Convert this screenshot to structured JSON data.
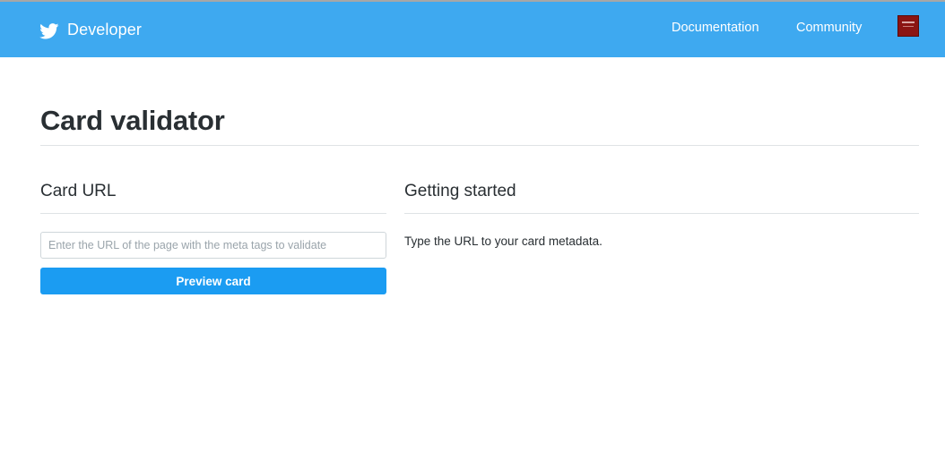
{
  "navbar": {
    "brand_icon": "twitter-bird-icon",
    "brand_label": "Developer",
    "links": [
      {
        "label": "Documentation"
      },
      {
        "label": "Community"
      }
    ],
    "avatar_icon": "user-avatar",
    "background_color": "#3ea9f0"
  },
  "page": {
    "title": "Card validator"
  },
  "card_url": {
    "heading": "Card URL",
    "input": {
      "value": "",
      "placeholder": "Enter the URL of the page with the meta tags to validate"
    },
    "preview_button_label": "Preview card",
    "button_color": "#1b9cf2"
  },
  "getting_started": {
    "heading": "Getting started",
    "text": "Type the URL to your card metadata."
  }
}
